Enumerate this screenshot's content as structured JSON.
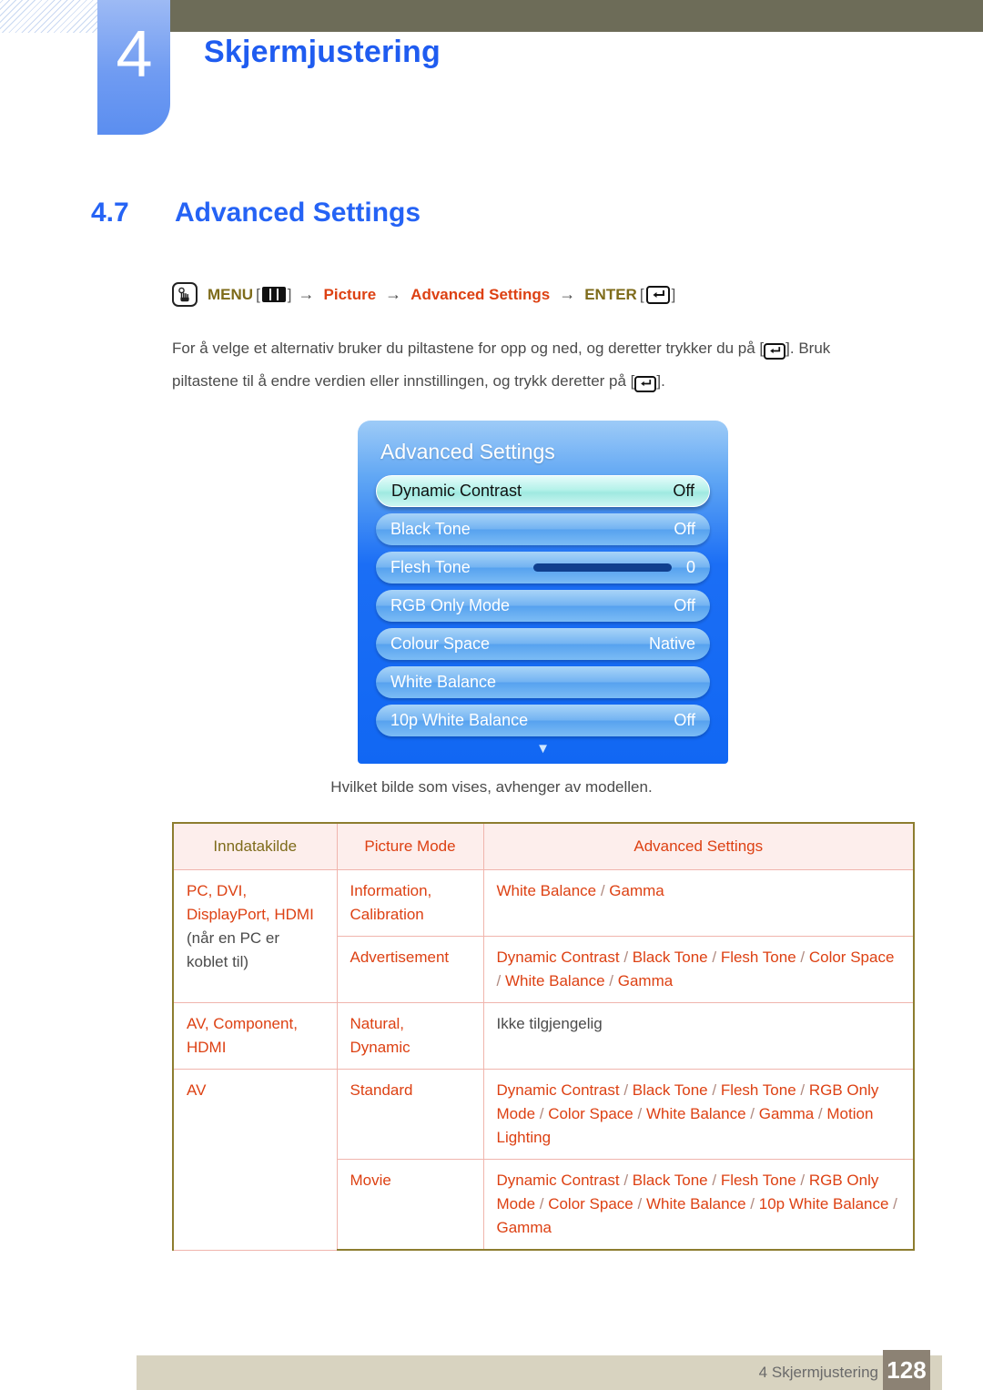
{
  "header": {
    "chapter_number": "4",
    "chapter_title": "Skjermjustering",
    "accent_color": "#1f5cf0",
    "olive_bar_color": "#6d6c58"
  },
  "section": {
    "number": "4.7",
    "title": "Advanced Settings",
    "color": "#2563f5"
  },
  "menu_path": {
    "hand_icon": "hand-press-icon",
    "menu_label": "MENU",
    "menu_key_icon": "menu-bars-icon",
    "arrow": "→",
    "picture_label": "Picture",
    "advanced_label": "Advanced Settings",
    "enter_label": "ENTER",
    "enter_key_icon": "enter-key-icon",
    "olive_color": "#7e6b1a",
    "red_color": "#dd4113"
  },
  "body": {
    "line1_a": "For å velge et alternativ bruker du piltastene for opp og ned, og deretter trykker du på [",
    "line1_b": "]. Bruk",
    "line2_a": "piltastene til å endre verdien eller innstillingen, og trykk deretter på [",
    "line2_b": "]."
  },
  "osd": {
    "title": "Advanced Settings",
    "scroll_chevron": "▼",
    "rows": [
      {
        "label": "Dynamic Contrast",
        "value": "Off",
        "selected": true,
        "type": "value"
      },
      {
        "label": "Black Tone",
        "value": "Off",
        "selected": false,
        "type": "value"
      },
      {
        "label": "Flesh Tone",
        "value": "0",
        "selected": false,
        "type": "slider",
        "slider_percent": 50
      },
      {
        "label": "RGB Only Mode",
        "value": "Off",
        "selected": false,
        "type": "value"
      },
      {
        "label": "Colour Space",
        "value": "Native",
        "selected": false,
        "type": "value"
      },
      {
        "label": "White Balance",
        "value": "",
        "selected": false,
        "type": "value"
      },
      {
        "label": "10p White Balance",
        "value": "Off",
        "selected": false,
        "type": "value"
      }
    ]
  },
  "caption": "Hvilket bilde som vises, avhenger av modellen.",
  "table": {
    "headers": [
      "Inndatakilde",
      "Picture Mode",
      "Advanced Settings"
    ],
    "rows": [
      {
        "source_red": "PC, DVI,",
        "source_red2": "DisplayPort, HDMI",
        "source_dark": "(når en PC er koblet til)",
        "modes": [
          {
            "mode_line1": "Information,",
            "mode_line2": "Calibration",
            "settings": "White Balance / Gamma"
          },
          {
            "mode_line1": "Advertisement",
            "mode_line2": "",
            "settings": "Dynamic Contrast / Black Tone / Flesh Tone / Color Space / White Balance / Gamma"
          }
        ]
      },
      {
        "source_red": "AV, Component,",
        "source_red2": "HDMI",
        "source_dark": "",
        "modes": [
          {
            "mode_line1": "Natural,",
            "mode_line2": "Dynamic",
            "settings": "Ikke tilgjengelig",
            "settings_dark": true
          }
        ]
      },
      {
        "source_red": "AV",
        "source_red2": "",
        "source_dark": "",
        "modes": [
          {
            "mode_line1": "Standard",
            "mode_line2": "",
            "settings": "Dynamic Contrast / Black Tone / Flesh Tone / RGB Only Mode / Color Space / White Balance / Gamma / Motion Lighting"
          },
          {
            "mode_line1": "Movie",
            "mode_line2": "",
            "settings": "Dynamic Contrast / Black Tone / Flesh Tone / RGB Only Mode / Color Space / White Balance / 10p White Balance / Gamma"
          }
        ]
      }
    ]
  },
  "footer": {
    "text": "4 Skjermjustering",
    "page_number": "128",
    "bar_color": "#d8d3c0",
    "box_color": "#8c8274"
  }
}
